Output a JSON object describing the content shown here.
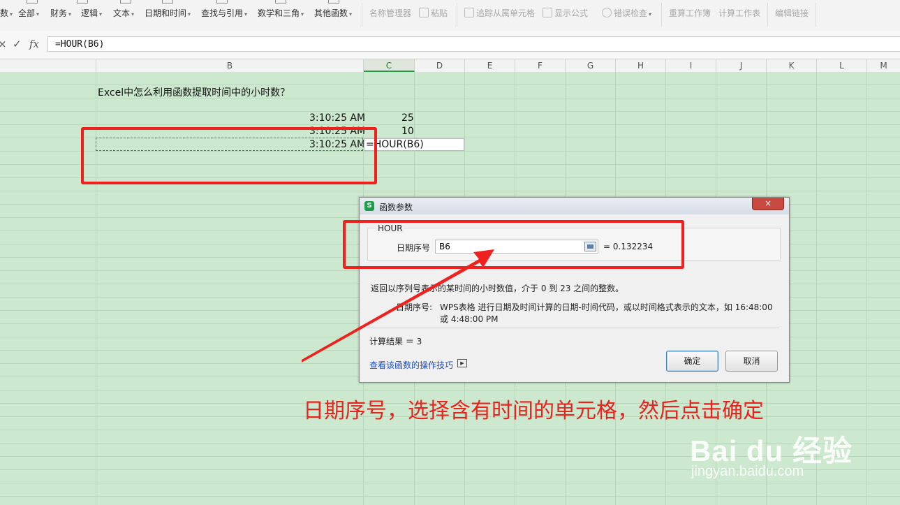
{
  "ribbon": {
    "items": [
      {
        "label": "数",
        "caret": true,
        "disabled": false
      },
      {
        "label": "全部",
        "caret": true,
        "disabled": false
      },
      {
        "label": "财务",
        "caret": true,
        "disabled": false
      },
      {
        "label": "逻辑",
        "caret": true,
        "disabled": false
      },
      {
        "label": "文本",
        "caret": true,
        "disabled": false
      },
      {
        "label": "日期和时间",
        "caret": true,
        "disabled": false
      },
      {
        "label": "查找与引用",
        "caret": true,
        "disabled": false
      },
      {
        "label": "数学和三角",
        "caret": true,
        "disabled": false
      },
      {
        "label": "其他函数",
        "caret": true,
        "disabled": false
      },
      {
        "label": "名称管理器",
        "caret": false,
        "disabled": true
      },
      {
        "label": "粘贴",
        "caret": false,
        "disabled": true
      },
      {
        "label": "追踪从属单元格",
        "caret": false,
        "disabled": true
      },
      {
        "label": "显示公式",
        "caret": false,
        "disabled": true
      },
      {
        "label": "错误检查",
        "caret": true,
        "disabled": true
      },
      {
        "label": "重算工作簿",
        "caret": false,
        "disabled": true
      },
      {
        "label": "计算工作表",
        "caret": false,
        "disabled": true
      },
      {
        "label": "编辑链接",
        "caret": false,
        "disabled": true
      }
    ]
  },
  "formula_bar": {
    "cancel_symbol": "×",
    "confirm_symbol": "✓",
    "fx_label": "fx",
    "formula": "=HOUR(B6)"
  },
  "columns": {
    "headers": [
      "B",
      "C",
      "D",
      "E",
      "F",
      "G",
      "H",
      "I",
      "J",
      "K",
      "L",
      "M"
    ],
    "active": "C"
  },
  "sheet": {
    "title": "Excel中怎么利用函数提取时间中的小时数？",
    "rows": [
      {
        "time": "3:10:25 AM",
        "result": "25"
      },
      {
        "time": "3:10:25 AM",
        "result": "10"
      },
      {
        "time": "3:10:25 AM",
        "result": ""
      }
    ],
    "editing_formula": "=HOUR(B6)"
  },
  "dialog": {
    "title": "函数参数",
    "logo_letter": "S",
    "close": "×",
    "function_name": "HOUR",
    "arg_label": "日期序号",
    "arg_value": "B6",
    "arg_result": "= 0.132234",
    "partial_hidden": "= ",
    "description": "返回以序列号表示的某时间的小时数值，介于 0 到 23 之间的整数。",
    "arg_help_label": "日期序号:",
    "arg_help_line1": "WPS表格 进行日期及时间计算的日期-时间代码，或以时间格式表示的文本，如 16:48:00",
    "arg_help_line2": "或 4:48:00 PM",
    "calc_result": "计算结果 ＝ 3",
    "help_link": "查看该函数的操作技巧",
    "play_icon": "▶",
    "ok_label": "确定",
    "cancel_label": "取消"
  },
  "annotation": {
    "caption": "日期序号，选择含有时间的单元格，然后点击确定",
    "color": "#e8221c"
  },
  "watermark": {
    "brand": "Bai du 经验",
    "url": "jingyan.baidu.com"
  }
}
